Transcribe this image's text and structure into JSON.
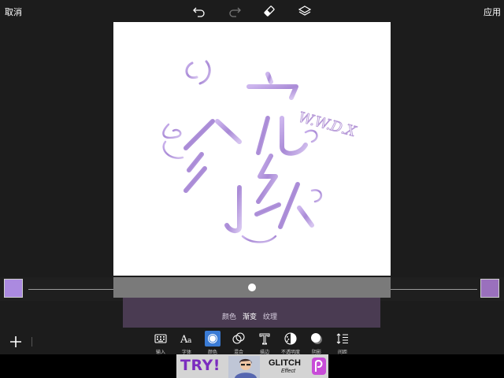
{
  "header": {
    "cancel_label": "取消",
    "apply_label": "应用",
    "icons": [
      "undo-icon",
      "redo-icon",
      "eraser-icon",
      "layers-icon"
    ]
  },
  "artwork": {
    "watermark_text": "W.W.D.X",
    "accent_color": "#b79ad8"
  },
  "gradient": {
    "start_color": "#ab8ae0",
    "end_color": "#9a70bd",
    "position_percent": 50
  },
  "tabs": [
    {
      "label": "颜色",
      "active": false
    },
    {
      "label": "渐变",
      "active": true
    },
    {
      "label": "纹理",
      "active": false
    }
  ],
  "tools": [
    {
      "label": "输入",
      "icon": "keyboard-icon"
    },
    {
      "label": "字体",
      "icon": "font-icon"
    },
    {
      "label": "颜色",
      "icon": "color-icon",
      "active": true
    },
    {
      "label": "混合",
      "icon": "blend-icon"
    },
    {
      "label": "描边",
      "icon": "stroke-icon"
    },
    {
      "label": "不透明度",
      "icon": "opacity-icon"
    },
    {
      "label": "阴影",
      "icon": "shadow-icon"
    },
    {
      "label": "间距",
      "icon": "spacing-icon"
    }
  ],
  "ad": {
    "try_text": "TRY!",
    "glitch_text": "GLITCH",
    "effect_text": "Effect"
  },
  "colors": {
    "background": "#1c1c1c",
    "tab_panel": "#4a3b52",
    "slider_box": "#7a7a7a",
    "active_tool": "#3a7bd5"
  }
}
